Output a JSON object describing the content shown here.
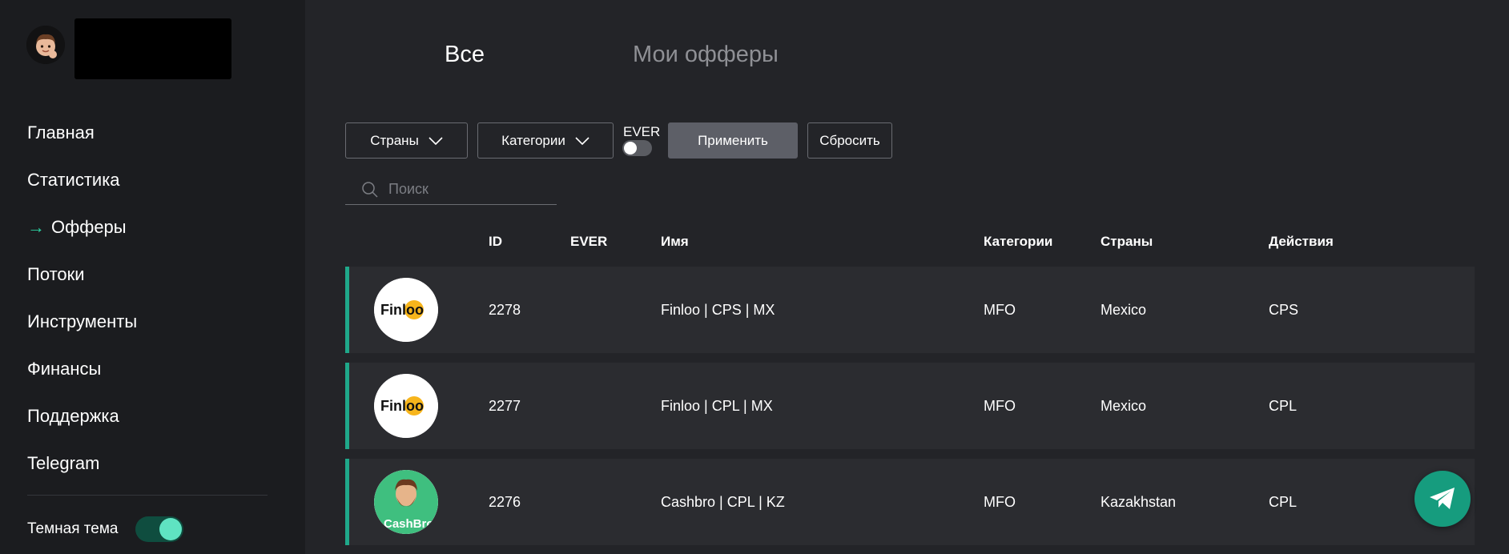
{
  "sidebar": {
    "items": [
      {
        "label": "Главная",
        "active": false
      },
      {
        "label": "Статистика",
        "active": false
      },
      {
        "label": "Офферы",
        "active": true
      },
      {
        "label": "Потоки",
        "active": false
      },
      {
        "label": "Инструменты",
        "active": false
      },
      {
        "label": "Финансы",
        "active": false
      },
      {
        "label": "Поддержка",
        "active": false
      },
      {
        "label": "Telegram",
        "active": false
      }
    ],
    "active_marker": "→",
    "theme_label": "Темная тема",
    "theme_dark_enabled": true
  },
  "tabs": {
    "all": "Все",
    "mine": "Мои офферы",
    "active": "all"
  },
  "filters": {
    "countries_label": "Страны",
    "categories_label": "Категории",
    "ever_label": "EVER",
    "ever_enabled": false,
    "apply_label": "Применить",
    "reset_label": "Сбросить"
  },
  "search": {
    "placeholder": "Поиск",
    "value": ""
  },
  "table": {
    "headers": {
      "id": "ID",
      "ever": "EVER",
      "name": "Имя",
      "categories": "Категории",
      "countries": "Страны",
      "actions": "Действия"
    },
    "rows": [
      {
        "logo": "Finloo",
        "id": "2278",
        "ever": "",
        "name": "Finloo | CPS | MX",
        "category": "MFO",
        "country": "Mexico",
        "action": "CPS"
      },
      {
        "logo": "Finloo",
        "id": "2277",
        "ever": "",
        "name": "Finloo | CPL | MX",
        "category": "MFO",
        "country": "Mexico",
        "action": "CPL"
      },
      {
        "logo": "CashBro",
        "id": "2276",
        "ever": "",
        "name": "Cashbro | CPL | KZ",
        "category": "MFO",
        "country": "Kazakhstan",
        "action": "CPL"
      }
    ]
  },
  "colors": {
    "accent": "#1fa88a",
    "sidebar_bg": "#1b1c1f",
    "content_bg": "#232428",
    "row_bg": "#2b2c30"
  },
  "icons": {
    "fab": "telegram-icon",
    "search": "search-icon",
    "dropdown": "chevron-down-icon"
  }
}
